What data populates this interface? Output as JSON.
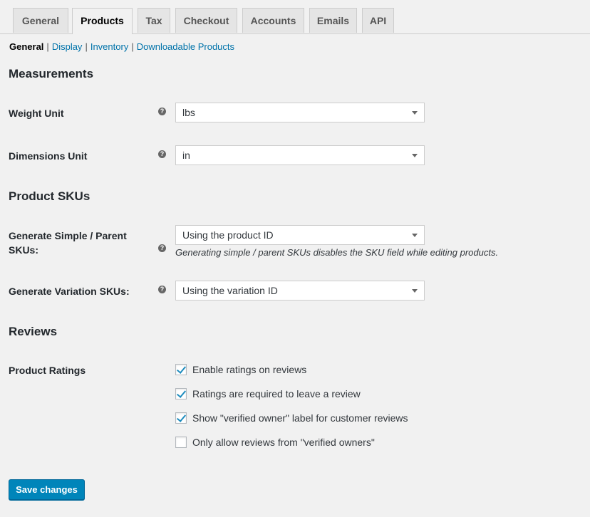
{
  "tabs": [
    {
      "label": "General",
      "active": false
    },
    {
      "label": "Products",
      "active": true
    },
    {
      "label": "Tax",
      "active": false
    },
    {
      "label": "Checkout",
      "active": false
    },
    {
      "label": "Accounts",
      "active": false
    },
    {
      "label": "Emails",
      "active": false
    },
    {
      "label": "API",
      "active": false
    }
  ],
  "subnav": {
    "current": "General",
    "links": [
      "Display",
      "Inventory",
      "Downloadable Products"
    ],
    "separator": "|"
  },
  "measurements": {
    "heading": "Measurements",
    "weight_unit": {
      "label": "Weight Unit",
      "value": "lbs"
    },
    "dimensions_unit": {
      "label": "Dimensions Unit",
      "value": "in"
    }
  },
  "skus": {
    "heading": "Product SKUs",
    "simple_label_line1": "Generate Simple / Parent",
    "simple_label_line2": "SKUs:",
    "simple_value": "Using the product ID",
    "simple_description": "Generating simple / parent SKUs disables the SKU field while editing products.",
    "variation_label": "Generate Variation SKUs:",
    "variation_value": "Using the variation ID"
  },
  "reviews": {
    "heading": "Reviews",
    "ratings_label": "Product Ratings",
    "options": [
      {
        "label": "Enable ratings on reviews",
        "checked": true
      },
      {
        "label": "Ratings are required to leave a review",
        "checked": true
      },
      {
        "label": "Show \"verified owner\" label for customer reviews",
        "checked": true
      },
      {
        "label": "Only allow reviews from \"verified owners\"",
        "checked": false
      }
    ]
  },
  "help_glyph": "?",
  "save_label": "Save changes",
  "colors": {
    "accent": "#0085ba",
    "link": "#0073aa",
    "background": "#f1f1f1"
  }
}
